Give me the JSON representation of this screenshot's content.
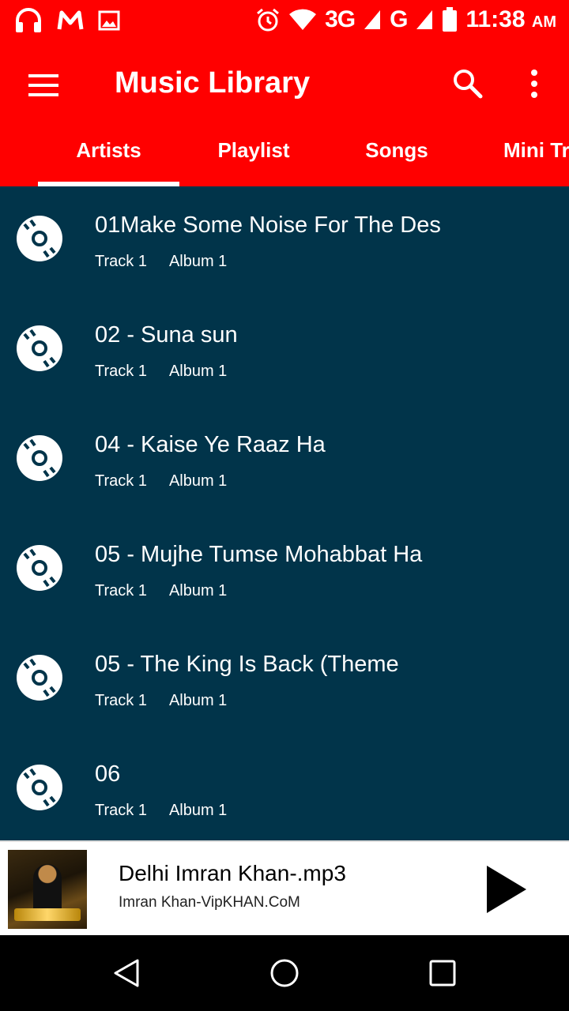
{
  "status_bar": {
    "time": "11:38",
    "ampm": "AM",
    "network_1": "3G",
    "network_2": "G",
    "icons": [
      "headphones-icon",
      "gmail-icon",
      "image-icon",
      "alarm-icon",
      "wifi-icon",
      "signal-icon",
      "battery-icon"
    ]
  },
  "app_bar": {
    "title": "Music Library",
    "menu_icon": "hamburger-menu-icon",
    "search_icon": "search-icon",
    "more_icon": "more-vertical-icon"
  },
  "tabs": [
    {
      "label": "Artists",
      "active": true
    },
    {
      "label": "Playlist",
      "active": false
    },
    {
      "label": "Songs",
      "active": false
    },
    {
      "label": "Mini Tr",
      "active": false
    }
  ],
  "tracks": [
    {
      "title": "01Make Some Noise For The Des",
      "track": "Track 1",
      "album": "Album 1"
    },
    {
      "title": "02 - Suna sun",
      "track": "Track 1",
      "album": "Album 1"
    },
    {
      "title": "04 - Kaise Ye Raaz Ha",
      "track": "Track 1",
      "album": "Album 1"
    },
    {
      "title": "05 - Mujhe Tumse Mohabbat Ha",
      "track": "Track 1",
      "album": "Album 1"
    },
    {
      "title": "05 - The King Is Back (Theme",
      "track": "Track 1",
      "album": "Album 1"
    },
    {
      "title": "06",
      "track": "Track 1",
      "album": "Album 1"
    }
  ],
  "now_playing": {
    "title": "Delhi Imran Khan-.mp3",
    "artist": "Imran Khan-VipKHAN.CoM",
    "play_icon": "play-icon"
  },
  "colors": {
    "accent": "#ff0000",
    "list_background": "#01344a",
    "text_on_accent": "#ffffff"
  }
}
